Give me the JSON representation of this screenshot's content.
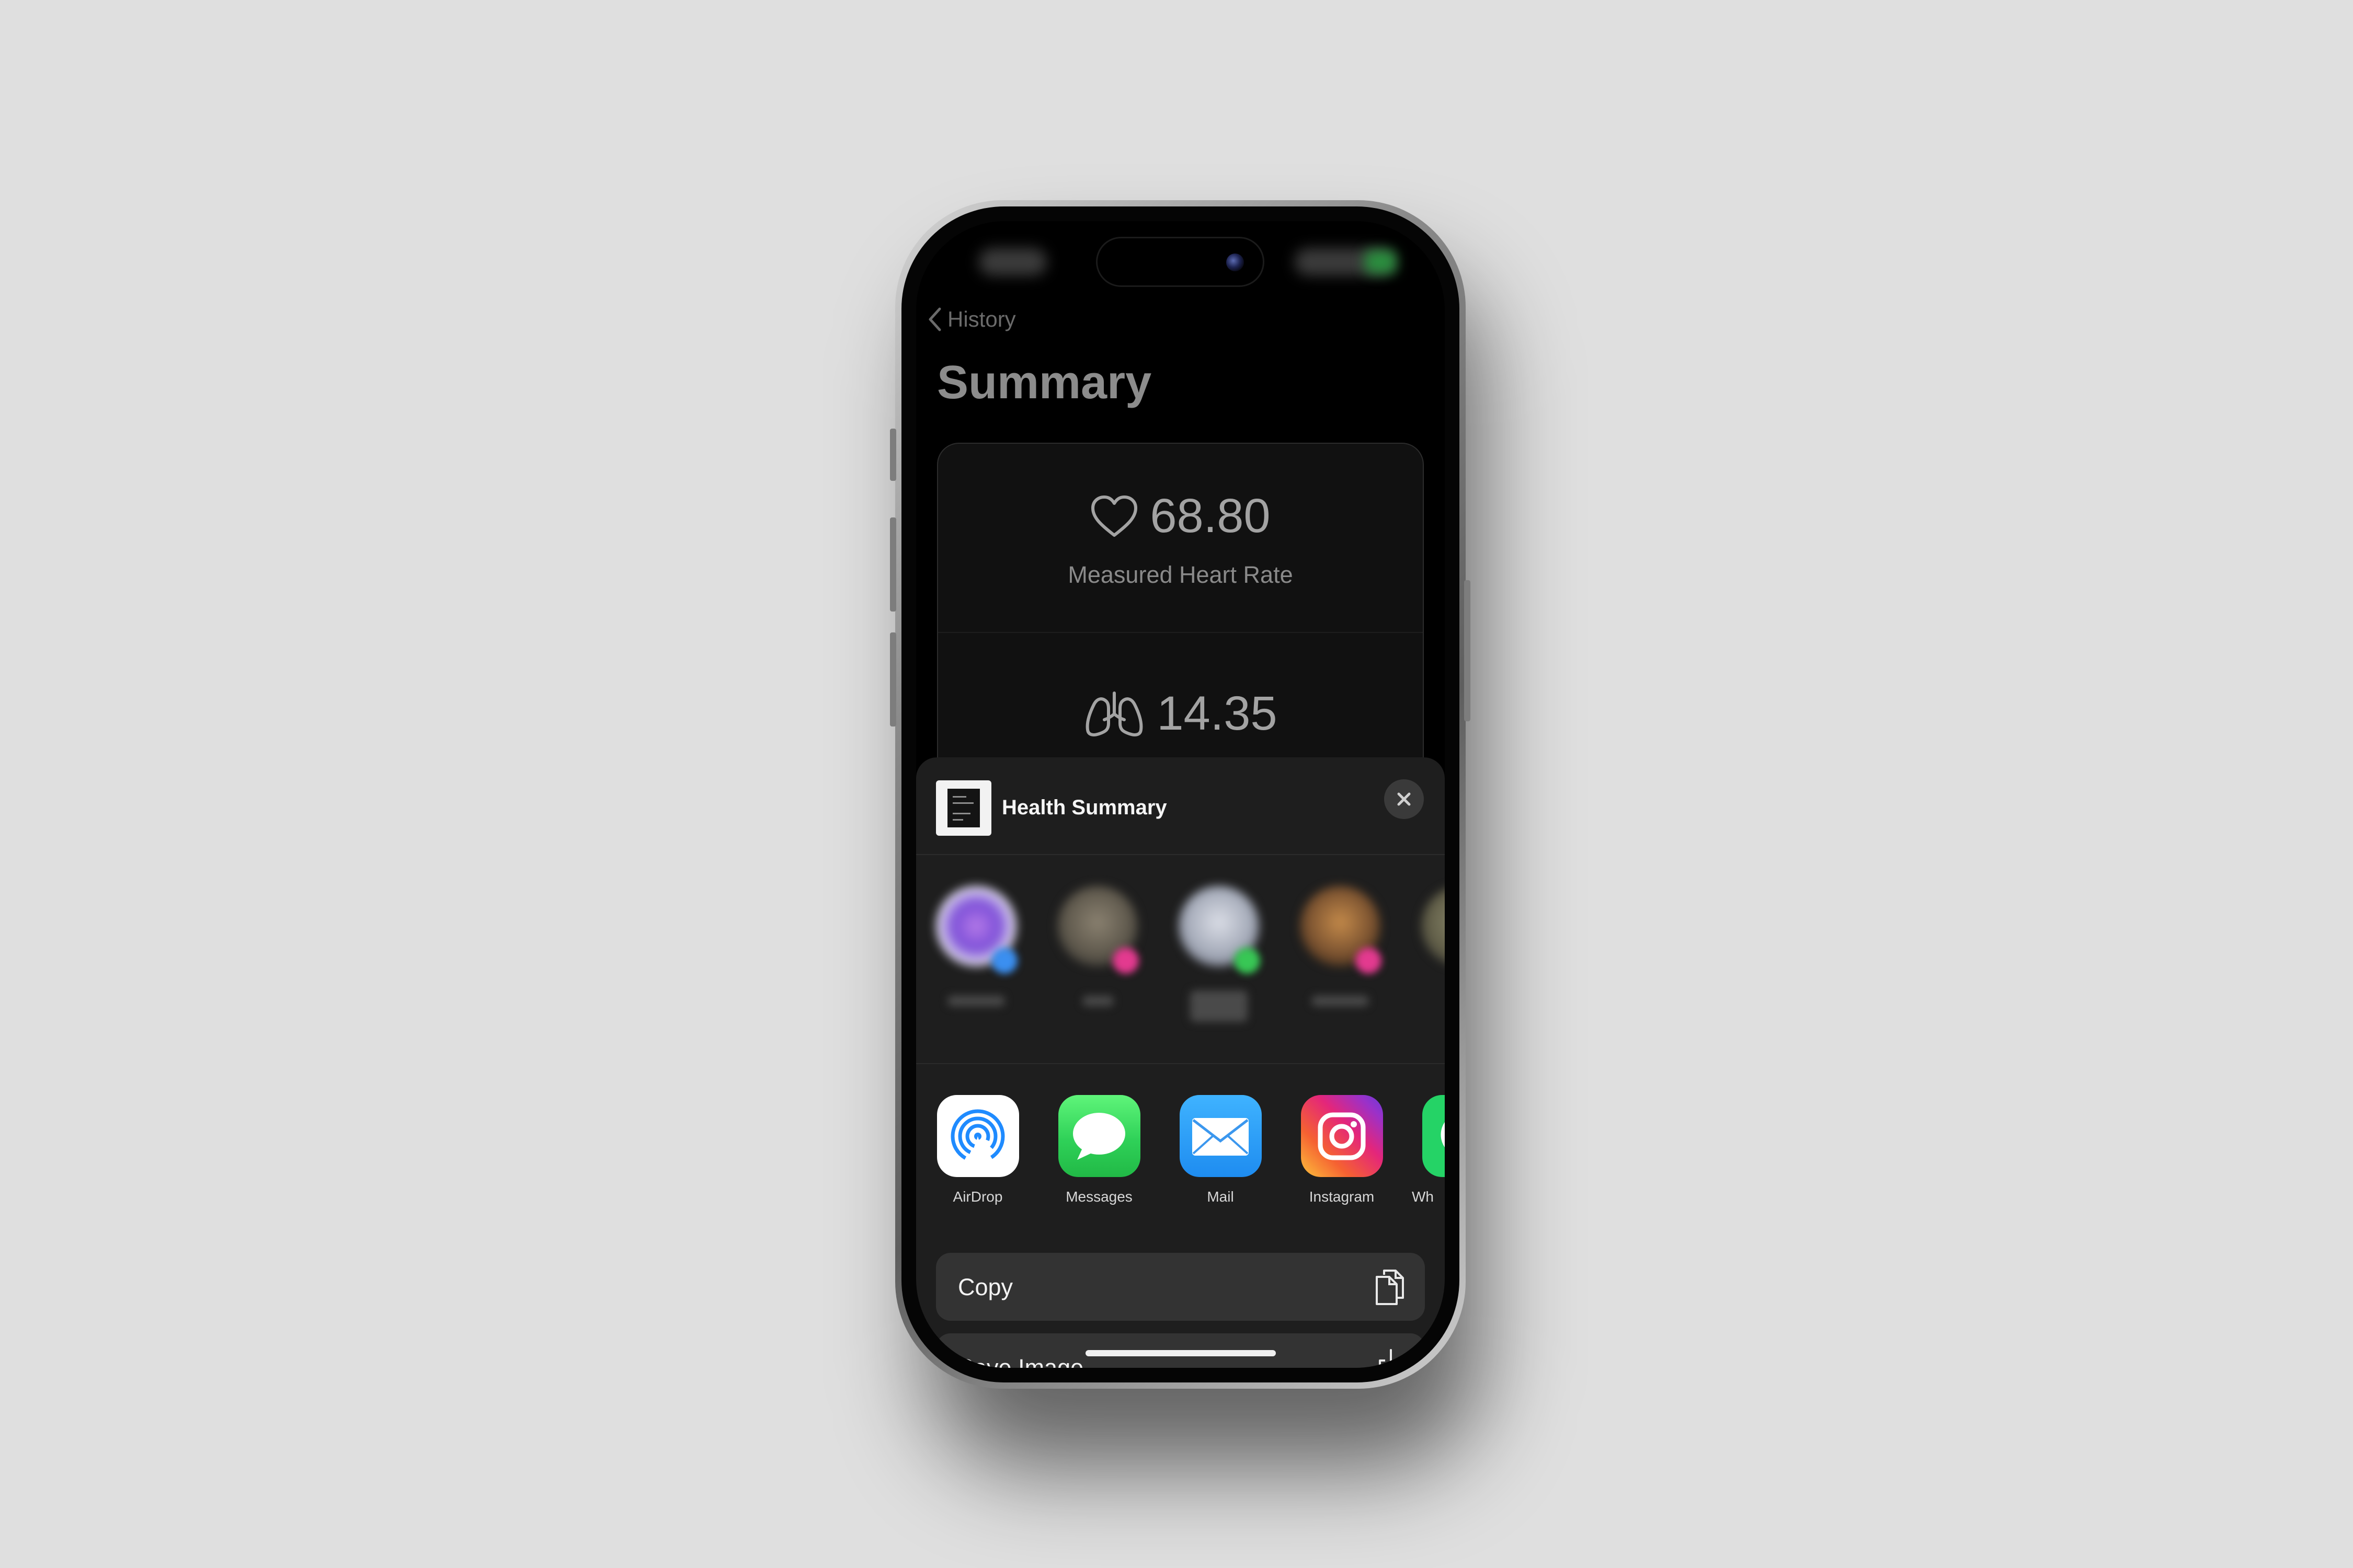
{
  "nav": {
    "back_label": "History"
  },
  "page": {
    "title": "Summary"
  },
  "metrics": [
    {
      "icon": "heart-icon",
      "value": "68.80",
      "label": "Measured Heart Rate"
    },
    {
      "icon": "lungs-icon",
      "value": "14.35"
    }
  ],
  "share_sheet": {
    "title": "Health Summary",
    "apps": [
      {
        "label": "AirDrop",
        "icon": "airdrop-icon"
      },
      {
        "label": "Messages",
        "icon": "messages-icon"
      },
      {
        "label": "Mail",
        "icon": "mail-icon"
      },
      {
        "label": "Instagram",
        "icon": "instagram-icon"
      },
      {
        "label": "Wh",
        "icon": "whatsapp-icon"
      }
    ],
    "actions": [
      {
        "label": "Copy",
        "icon": "copy-icon"
      },
      {
        "label": "Save Image",
        "icon": "save-image-icon"
      }
    ]
  },
  "colors": {
    "background": "#dfdfdf",
    "screen": "#000000",
    "sheet": "#1e1e1e",
    "action_row": "#333333",
    "messages_green": "#2fd158",
    "mail_blue": "#1e8cf0",
    "airdrop_blue": "#1f8bff"
  }
}
